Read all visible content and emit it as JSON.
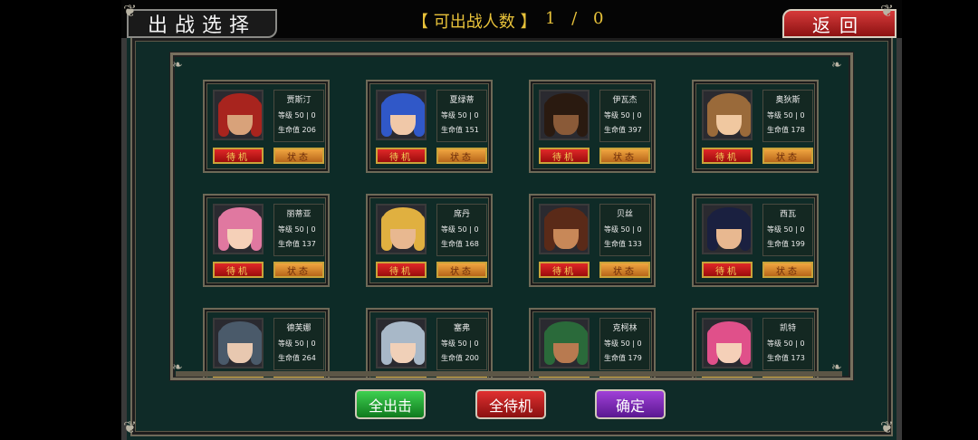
{
  "header": {
    "title": "出战选择",
    "count_label": "【 可出战人数 】",
    "count_value": "1 / 0",
    "back_label": "返回"
  },
  "card_labels": {
    "level_prefix": "等级",
    "hp_prefix": "生命值",
    "wait_label": "待机",
    "status_label": "状态"
  },
  "units": [
    {
      "name": "贾斯汀",
      "level": "50 | 0",
      "hp": "206",
      "hair": "#a8241e",
      "face": "#d8a27a"
    },
    {
      "name": "夏绿蒂",
      "level": "50 | 0",
      "hp": "151",
      "hair": "#3058c8",
      "face": "#f0c8a8"
    },
    {
      "name": "伊瓦杰",
      "level": "50 | 0",
      "hp": "397",
      "hair": "#2a1a10",
      "face": "#8a5a38"
    },
    {
      "name": "奥狄斯",
      "level": "50 | 0",
      "hp": "178",
      "hair": "#9a6a3a",
      "face": "#f0c8a0"
    },
    {
      "name": "丽蒂亚",
      "level": "50 | 0",
      "hp": "137",
      "hair": "#e078a0",
      "face": "#f5d0b8"
    },
    {
      "name": "席丹",
      "level": "50 | 0",
      "hp": "168",
      "hair": "#e0b040",
      "face": "#e8b890"
    },
    {
      "name": "贝丝",
      "level": "50 | 0",
      "hp": "133",
      "hair": "#5a2a18",
      "face": "#c88858"
    },
    {
      "name": "西瓦",
      "level": "50 | 0",
      "hp": "199",
      "hair": "#1a2040",
      "face": "#e8b890"
    },
    {
      "name": "德芙娜",
      "level": "50 | 0",
      "hp": "264",
      "hair": "#4a5a6a",
      "face": "#e8c8b0"
    },
    {
      "name": "塞弗",
      "level": "50 | 0",
      "hp": "200",
      "hair": "#a8b8c8",
      "face": "#f0d0b8"
    },
    {
      "name": "克柯林",
      "level": "50 | 0",
      "hp": "179",
      "hair": "#2a6a3a",
      "face": "#b87a50"
    },
    {
      "name": "凯特",
      "level": "50 | 0",
      "hp": "173",
      "hair": "#e0508a",
      "face": "#f5d0b8"
    }
  ],
  "bottom_buttons": {
    "all_attack": "全出击",
    "all_wait": "全待机",
    "confirm": "确定"
  },
  "colors": {
    "background": "#0f2b28",
    "count_text": "#e8c23a",
    "back_button": "#c02828",
    "wait_button": "#c81818",
    "status_button": "#e08a30"
  }
}
